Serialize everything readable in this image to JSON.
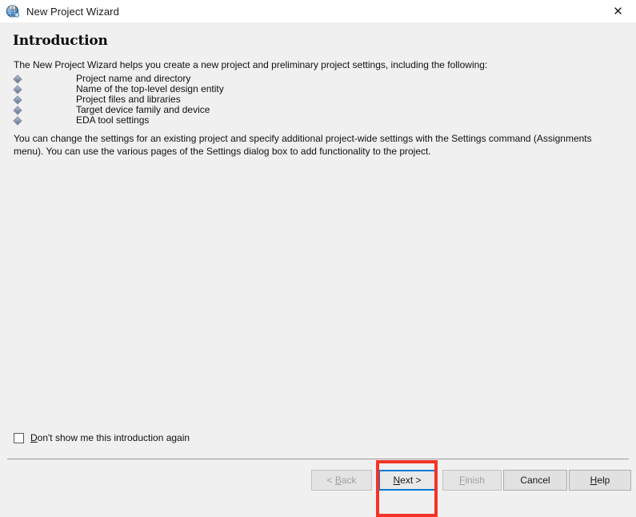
{
  "window": {
    "title": "New Project Wizard",
    "icon": "quartus-globe-icon",
    "close_label": "✕",
    "titlebar_bg": "#ffffff",
    "body_bg": "#f0f0f0"
  },
  "page": {
    "heading": "Introduction",
    "intro": "The New Project Wizard helps you create a new project and preliminary project settings, including the following:",
    "bullets": [
      {
        "label": "Project name and directory"
      },
      {
        "label": "Name of the top-level design entity"
      },
      {
        "label": "Project files and libraries"
      },
      {
        "label": "Target device family and device"
      },
      {
        "label": "EDA tool settings"
      }
    ],
    "paragraph": "You can change the settings for an existing project and specify additional project-wide settings with the Settings command (Assignments menu). You can use the various pages of the Settings dialog box to add functionality to the project."
  },
  "checkbox": {
    "accel": "D",
    "label_rest": "on't show me this introduction again",
    "checked": false
  },
  "buttons": {
    "back": {
      "prefix": "< ",
      "accel": "B",
      "suffix": "ack",
      "enabled": false,
      "focused": false
    },
    "next": {
      "prefix": "",
      "accel": "N",
      "suffix": "ext >",
      "enabled": true,
      "focused": true
    },
    "finish": {
      "prefix": "",
      "accel": "F",
      "suffix": "inish",
      "enabled": false,
      "focused": false
    },
    "cancel": {
      "prefix": "",
      "accel": "",
      "suffix": "Cancel",
      "enabled": true,
      "focused": false
    },
    "help": {
      "prefix": "",
      "accel": "H",
      "suffix": "elp",
      "enabled": true,
      "focused": false
    }
  },
  "annotation": {
    "color": "#f23427",
    "target": "next-button"
  }
}
